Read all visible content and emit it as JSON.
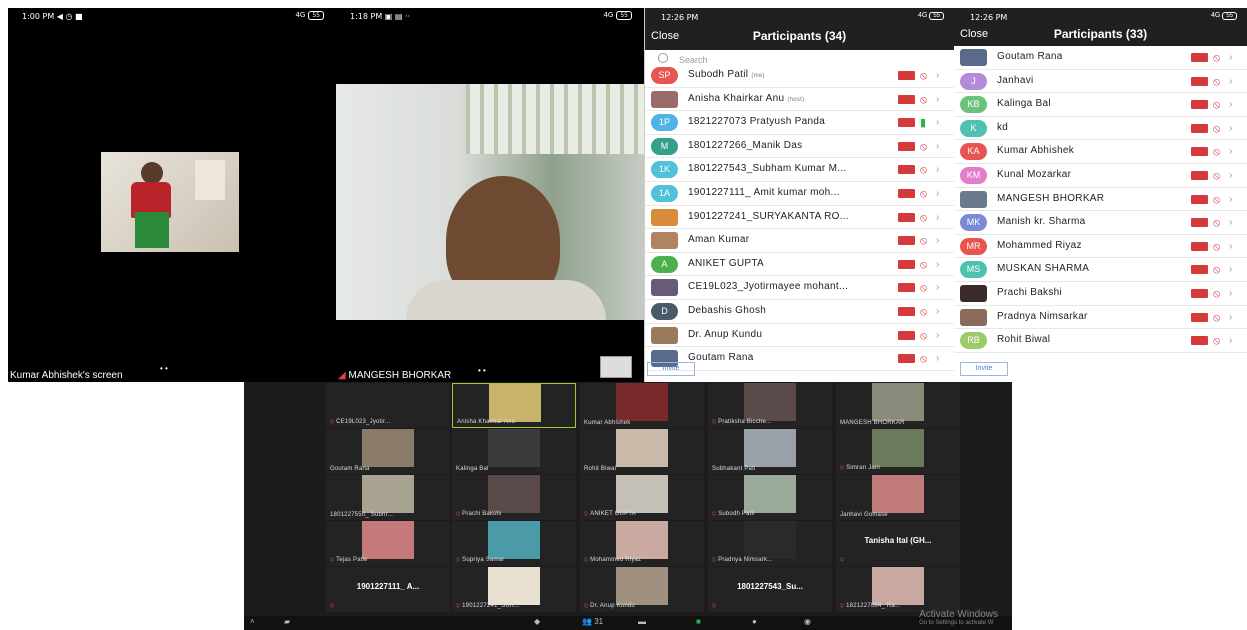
{
  "panel1": {
    "status_time": "1:00 PM",
    "status_right": "4G",
    "battery": "55",
    "screen_label": "Kumar Abhishek's screen"
  },
  "panel2": {
    "status_time": "1:18 PM",
    "status_right": "4G",
    "battery": "55",
    "speaker_label": "MANGESH BHORKAR"
  },
  "panel3": {
    "status_time": "12:26 PM",
    "close": "Close",
    "title": "Participants (34)",
    "search_placeholder": "Search",
    "invite": "Invite",
    "rows": [
      {
        "initials": "SP",
        "name": "Subodh Patil",
        "tag": "(me)",
        "color": "#e8544f"
      },
      {
        "initials": "",
        "name": "Anisha Khairkar Anu",
        "tag": "(host)",
        "color": "#9a6b6b"
      },
      {
        "initials": "1P",
        "name": "1821227073 Pratyush Panda",
        "tag": "",
        "color": "#4fb3e8",
        "mic": "on"
      },
      {
        "initials": "M",
        "name": "1801227266_Manik Das",
        "tag": "",
        "color": "#34a08a"
      },
      {
        "initials": "1K",
        "name": "1801227543_Subham Kumar M...",
        "tag": "",
        "color": "#4fc1d8"
      },
      {
        "initials": "1A",
        "name": "1901227111_ Amit kumar moh...",
        "tag": "",
        "color": "#4fc1d8"
      },
      {
        "initials": "",
        "name": "1901227241_SURYAKANTA RO...",
        "tag": "",
        "color": "#d98b3a"
      },
      {
        "initials": "",
        "name": "Aman Kumar",
        "tag": "",
        "color": "#b08460"
      },
      {
        "initials": "A",
        "name": "ANIKET GUPTA",
        "tag": "",
        "color": "#4cb04c"
      },
      {
        "initials": "",
        "name": "CE19L023_Jyotirmayee mohant...",
        "tag": "",
        "color": "#6a5a7a"
      },
      {
        "initials": "D",
        "name": "Debashis Ghosh",
        "tag": "",
        "color": "#4a5a66"
      },
      {
        "initials": "",
        "name": "Dr. Anup Kundu",
        "tag": "",
        "color": "#9a7a5a"
      },
      {
        "initials": "",
        "name": "Goutam Rana",
        "tag": "",
        "color": "#5a6a8a"
      }
    ]
  },
  "panel4": {
    "status_time": "12:26 PM",
    "close": "Close",
    "title": "Participants (33)",
    "invite": "Invite",
    "rows": [
      {
        "initials": "",
        "name": "Goutam Rana",
        "color": "#5a6a8a"
      },
      {
        "initials": "J",
        "name": "Janhavi",
        "color": "#b38bd8"
      },
      {
        "initials": "KB",
        "name": "Kalinga Bal",
        "color": "#6cc27a"
      },
      {
        "initials": "K",
        "name": "kd",
        "color": "#4fc1b0"
      },
      {
        "initials": "KA",
        "name": "Kumar Abhishek",
        "color": "#e8544f"
      },
      {
        "initials": "KM",
        "name": "Kunal Mozarkar",
        "color": "#e47dc8"
      },
      {
        "initials": "",
        "name": "MANGESH BHORKAR",
        "color": "#6a7a8a"
      },
      {
        "initials": "MK",
        "name": "Manish kr. Sharma",
        "color": "#7a8ad8"
      },
      {
        "initials": "MR",
        "name": "Mohammed Riyaz",
        "color": "#e8544f"
      },
      {
        "initials": "MS",
        "name": "MUSKAN SHARMA",
        "color": "#4fc1b0"
      },
      {
        "initials": "",
        "name": "Prachi Bakshi",
        "color": "#3a2a2a"
      },
      {
        "initials": "",
        "name": "Pradnya Nimsarkar",
        "color": "#8a6a5a"
      },
      {
        "initials": "RB",
        "name": "Rohit Biwal",
        "color": "#9ccc6a"
      }
    ]
  },
  "gallery": {
    "tiles": [
      {
        "label": "CE19L023_Jyotir...",
        "video": false,
        "muted": true
      },
      {
        "label": "Anisha Khairkar Anu",
        "video": true,
        "muted": false,
        "active": true,
        "color": "#c7b46a"
      },
      {
        "label": "Kumar Abhishek",
        "video": true,
        "muted": false,
        "color": "#7a2a2a"
      },
      {
        "label": "Pratiksha Bicche...",
        "video": true,
        "muted": true,
        "color": "#5a4a4a"
      },
      {
        "label": "MANGESH BHORKAR",
        "video": true,
        "muted": false,
        "color": "#8a8a7a"
      },
      {
        "label": "Goutam Rana",
        "video": true,
        "muted": false,
        "color": "#8a7a6a"
      },
      {
        "label": "Kalinga Bal",
        "video": true,
        "muted": false,
        "color": "#3a3a3a"
      },
      {
        "label": "Rohit Biwal",
        "video": true,
        "muted": false,
        "color": "#c9b9a9"
      },
      {
        "label": "Subhakant Pati",
        "video": true,
        "muted": false,
        "color": "#9aa0a8"
      },
      {
        "label": "Simran Jain",
        "video": true,
        "muted": true,
        "color": "#6a7a5a"
      },
      {
        "label": "1801227550_ Subhr...",
        "video": true,
        "muted": false,
        "color": "#a8a290"
      },
      {
        "label": "Prachi Bakshi",
        "video": true,
        "muted": true,
        "color": "#5a4a4a"
      },
      {
        "label": "ANIKET GUPTA",
        "video": true,
        "muted": true,
        "color": "#c4c0b8"
      },
      {
        "label": "Subodh Patil",
        "video": true,
        "muted": true,
        "color": "#9aaa9a"
      },
      {
        "label": "Janhavi Gomase",
        "video": true,
        "muted": false,
        "color": "#c07a7a"
      },
      {
        "label": "Tejas Patle",
        "video": true,
        "muted": true,
        "color": "#c47a7a"
      },
      {
        "label": "Supriya Samal",
        "video": true,
        "muted": true,
        "color": "#4a9aa8"
      },
      {
        "label": "Mohammed Riyaz",
        "video": true,
        "muted": true,
        "color": "#caa9a0"
      },
      {
        "label": "Pradnya Nimsark...",
        "video": true,
        "muted": true,
        "color": "#2a2a2a"
      },
      {
        "label": "",
        "big": "Tanisha Ital (GH...",
        "video": false,
        "muted": true
      },
      {
        "label": "",
        "big": "1901227111_ A...",
        "video": false,
        "muted": true
      },
      {
        "label": "1901227241_SUR...",
        "video": true,
        "muted": true,
        "color": "#e8e0d0"
      },
      {
        "label": "Dr. Anup Kundu",
        "video": true,
        "muted": true,
        "color": "#a09080"
      },
      {
        "label": "",
        "big": "1801227543_Su...",
        "video": false,
        "muted": true
      },
      {
        "label": "1821227084_ Ra...",
        "video": true,
        "muted": true,
        "color": "#c8a8a0"
      }
    ],
    "participants_count": "31",
    "watermark_title": "Activate Windows",
    "watermark_sub": "Go to Settings to activate W"
  }
}
